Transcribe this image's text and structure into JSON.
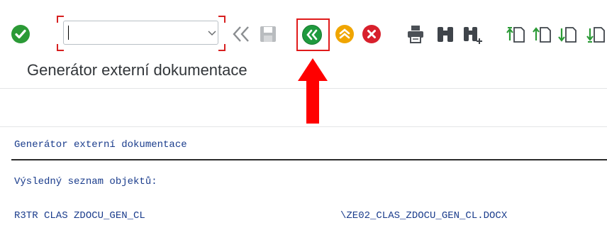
{
  "toolbar": {
    "command_field_value": "",
    "icons": {
      "enter": "checkmark-icon",
      "cmd_dropdown": "chevron-down-icon",
      "exit": "double-chevron-left-icon",
      "save": "floppy-disk-icon",
      "back": "double-chevron-left-circle-icon",
      "up": "double-chevron-up-circle-icon",
      "cancel": "x-circle-icon",
      "print": "printer-icon",
      "find": "binoculars-icon",
      "find_next": "binoculars-plus-icon",
      "first_page": "page-first-icon",
      "prev_page": "page-up-icon",
      "next_page": "page-down-icon",
      "last_page": "page-last-icon"
    },
    "colors": {
      "enter": "#2b9a36",
      "back": "#1f9a3e",
      "up": "#f0a500",
      "cancel": "#d8202c",
      "highlight": "#e01b1b",
      "page_icons": "#2b9a36"
    }
  },
  "page": {
    "title": "Generátor externí dokumentace"
  },
  "annotation": {
    "highlight_color": "#e01b1b",
    "arrow_icon": "red-up-arrow-icon"
  },
  "list": {
    "heading": "Generátor externí dokumentace",
    "result_label": "Výsledný seznam objektů:",
    "rows": [
      {
        "object": "R3TR CLAS ZDOCU_GEN_CL",
        "file": "\\ZE02_CLAS_ZDOCU_GEN_CL.DOCX"
      }
    ],
    "text_color": "#1a3c8c"
  }
}
